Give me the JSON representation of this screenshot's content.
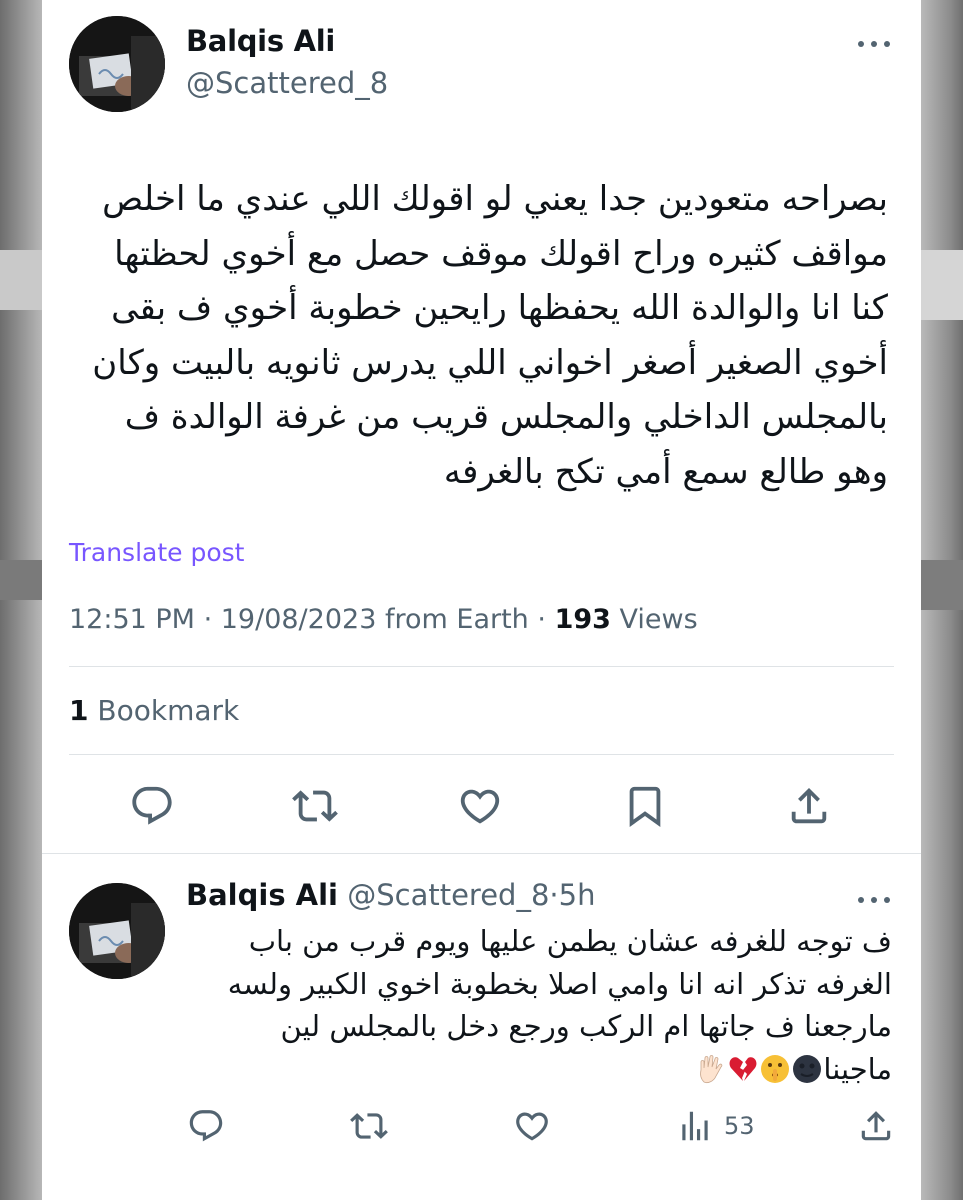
{
  "tweet": {
    "author_name": "Balqis Ali",
    "author_handle": "@Scattered_8",
    "text_lines": [
      "بصراحه متعودين جدا يعني لو اقولك اللي عندي ما اخلص",
      "مواقف كثيره وراح اقولك موقف حصل مع أخوي لحظتها",
      "كنا انا والوالدة الله يحفظها رايحين خطوبة أخوي ف بقى",
      "أخوي الصغير أصغر اخواني اللي يدرس ثانويه بالبيت وكان",
      "بالمجلس الداخلي والمجلس قريب من غرفة الوالدة ف",
      "وهو طالع سمع أمي تكح بالغرفه"
    ],
    "translate_label": "Translate post",
    "time": "12:51 PM",
    "date": "19/08/2023",
    "source": "from Earth",
    "views_count": "193",
    "views_label": "Views",
    "bookmark_count": "1",
    "bookmark_label": "Bookmark",
    "actions": [
      "reply-icon",
      "retweet-icon",
      "like-icon",
      "bookmark-icon",
      "share-icon"
    ]
  },
  "reply": {
    "author_name": "Balqis Ali",
    "author_handle": "@Scattered_8",
    "separator": "·",
    "time_ago": "5h",
    "text_lines": [
      "ف توجه للغرفه عشان يطمن عليها ويوم قرب من باب",
      "الغرفه تذكر انه انا وامي اصلا بخطوبة اخوي الكبير ولسه",
      "مارجعنا ف جاتها ام الركب ورجع دخل بالمجلس لين",
      "ماجينا"
    ],
    "emojis": [
      "new-moon-face-emoji",
      "shushing-face-emoji",
      "broken-heart-emoji",
      "raised-hand-emoji"
    ],
    "views_count": "53",
    "actions": [
      "reply-icon",
      "retweet-icon",
      "like-icon",
      "views-icon",
      "share-icon"
    ]
  },
  "colors": {
    "text": "#0f1419",
    "muted": "#536471",
    "link": "#7856ff",
    "divider": "#dfe3e6"
  }
}
